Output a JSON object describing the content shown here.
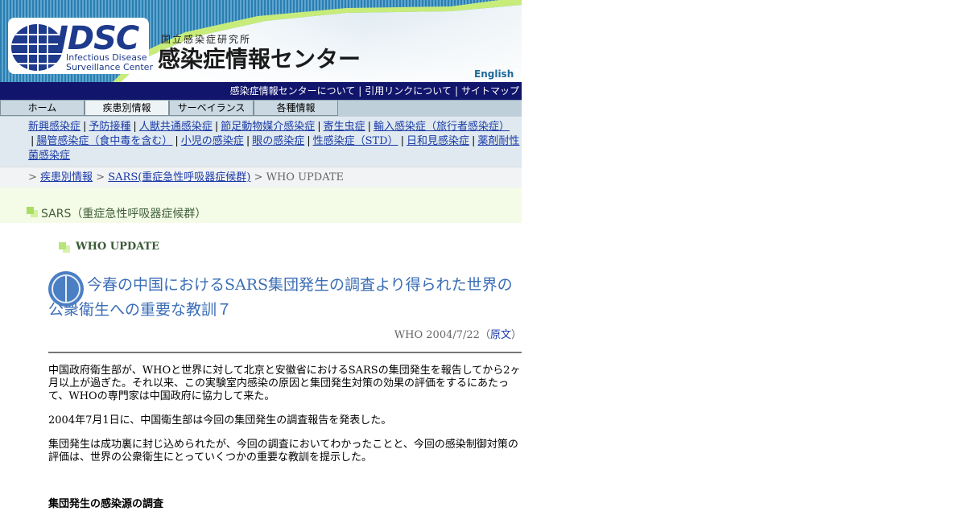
{
  "header": {
    "logo_text": "IDSC",
    "logo_sub_1": "Infectious Disease",
    "logo_sub_2": "Surveillance Center",
    "org_name": "国立感染症研究所",
    "center_name": "感染症情報センター",
    "english_link": "English"
  },
  "top_links": [
    "感染症情報センターについて",
    "引用リンクについて",
    "サイトマップ"
  ],
  "tabs": [
    {
      "label": "ホーム"
    },
    {
      "label": "疾患別情報"
    },
    {
      "label": "サーベイランス"
    },
    {
      "label": "各種情報"
    }
  ],
  "categories": [
    "新興感染症",
    "予防接種",
    "人獣共通感染症",
    "節足動物媒介感染症",
    "寄生虫症",
    "輸入感染症（旅行者感染症）",
    "腸管感染症（食中毒を含む）",
    "小児の感染症",
    "眼の感染症",
    "性感染症（STD）",
    "日和見感染症",
    "薬剤耐性菌感染症"
  ],
  "breadcrumb": {
    "sep": ">",
    "items": [
      "疾患別情報",
      "SARS(重症急性呼吸器症候群)"
    ],
    "current": "WHO UPDATE"
  },
  "section_title": "SARS（重症急性呼吸器症候群）",
  "subsection_title": "WHO UPDATE",
  "article": {
    "title": "今春の中国におけるSARS集団発生の調査より得られた世界の公衆衛生への重要な教訓７",
    "source": "WHO 2004/7/22",
    "original_label": "原文",
    "paragraphs": [
      "中国政府衛生部が、WHOと世界に対して北京と安徽省におけるSARSの集団発生を報告してから2ヶ月以上が過ぎた。それ以来、この実験室内感染の原因と集団発生対策の効果の評価をするにあたって、WHOの専門家は中国政府に協力して来た。",
      "2004年7月1日に、中国衛生部は今回の集団発生の調査報告を発表した。",
      "集団発生は成功裏に封じ込められたが、今回の調査においてわかったことと、今回の感染制御対策の評価は、世界の公衆衛生にとっていくつかの重要な教訓を提示した。"
    ],
    "heading_1": "集団発生の感染源の調査"
  },
  "colors": {
    "navy_bar": "#11156b",
    "link": "#1a3aa6",
    "title_blue": "#3a6db5",
    "section_band": "#f4fbe6"
  }
}
